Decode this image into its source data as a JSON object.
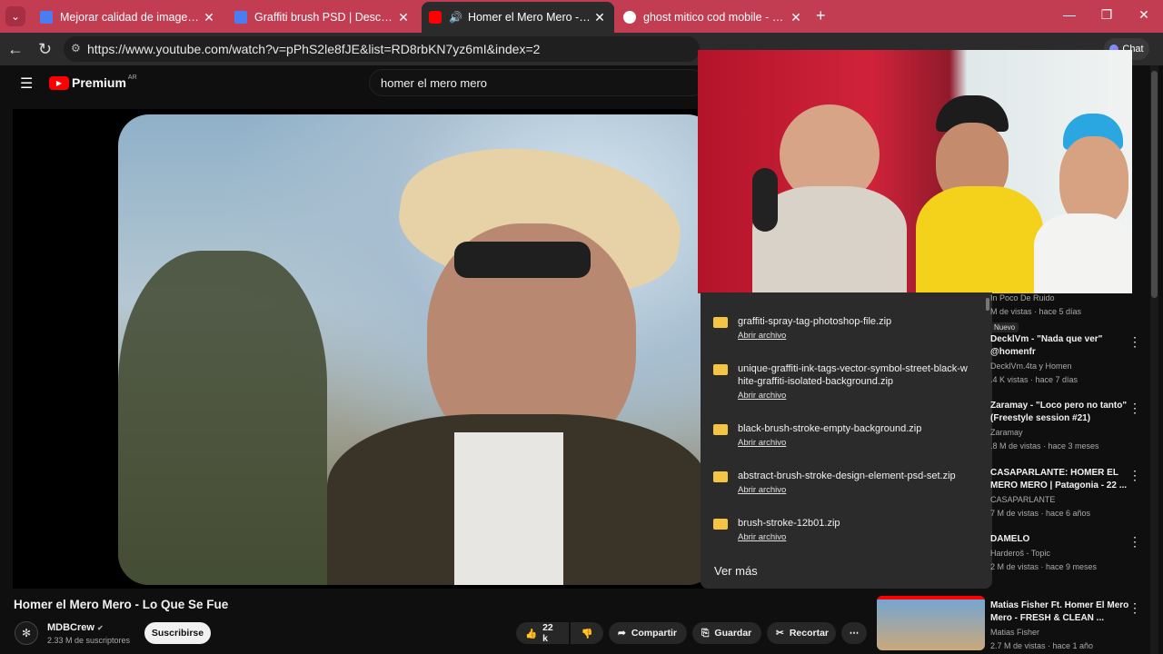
{
  "browser": {
    "tabs": [
      {
        "title": "Mejorar calidad de imagen | Freepik",
        "favicon_color": "#4a7df2"
      },
      {
        "title": "Graffiti brush PSD | Descarga gratuita",
        "favicon_color": "#4a7df2"
      },
      {
        "title": "Homer el Mero Mero - Lo Que Se Fue",
        "favicon_color": "#ff0000"
      },
      {
        "title": "ghost mitico cod mobile - Buscar con Google",
        "favicon_color": "#4285f4"
      }
    ],
    "new_tab_label": "+",
    "url": "https://www.youtube.com/watch?v=pPhS2le8fJE&list=RD8rbKN7yz6mI&index=2",
    "update_label": "Actualizar",
    "chat_label": "Chat"
  },
  "youtube": {
    "logo_text": "Premium",
    "region": "AR",
    "search_value": "homer el mero mero",
    "video_title": "Homer el Mero Mero - Lo Que Se Fue",
    "channel_name": "MDBCrew",
    "subscribers": "2.33 M de suscriptores",
    "subscribe_label": "Suscribirse",
    "likes": "22 k",
    "share_label": "Compartir",
    "save_label": "Guardar",
    "clip_label": "Recortar"
  },
  "downloads": {
    "items": [
      {
        "name": "graffiti-spray-tag-photoshop-file.zip",
        "action": "Abrir archivo"
      },
      {
        "name": "unique-graffiti-ink-tags-vector-symbol-street-black-white-graffiti-isolated-background.zip",
        "action": "Abrir archivo"
      },
      {
        "name": "black-brush-stroke-empty-background.zip",
        "action": "Abrir archivo"
      },
      {
        "name": "abstract-brush-stroke-design-element-psd-set.zip",
        "action": "Abrir archivo"
      },
      {
        "name": "brush-stroke-12b01.zip",
        "action": "Abrir archivo"
      }
    ],
    "more_label": "Ver más"
  },
  "related": [
    {
      "title": "",
      "channel": "In Poco De Ruido",
      "meta": "M de vistas · hace 5 días",
      "badge": "Nuevo"
    },
    {
      "title": "DecklVm - \"Nada que ver\" @homenfr",
      "channel": "DecklVm.4ta y Homen",
      "meta": ".4 K vistas · hace 7 días"
    },
    {
      "title": "Zaramay - \"Loco pero no tanto\" (Freestyle session #21)",
      "channel": "Zaramay",
      "meta": ".8 M de vistas · hace 3 meses"
    },
    {
      "title": "CASAPARLANTE: HOMER EL MERO MERO | Patagonia - 22 ...",
      "channel": "CASAPARLANTE",
      "meta": "7 M de vistas · hace 6 años"
    },
    {
      "title": "DAMELO",
      "channel": "Harderoš - Topic",
      "meta": "2 M de vistas · hace 9 meses"
    },
    {
      "title": "Matias Fisher Ft. Homer El Mero Mero - FRESH & CLEAN ...",
      "channel": "Matias Fisher",
      "meta": "2.7 M de vistas · hace 1 año"
    }
  ]
}
